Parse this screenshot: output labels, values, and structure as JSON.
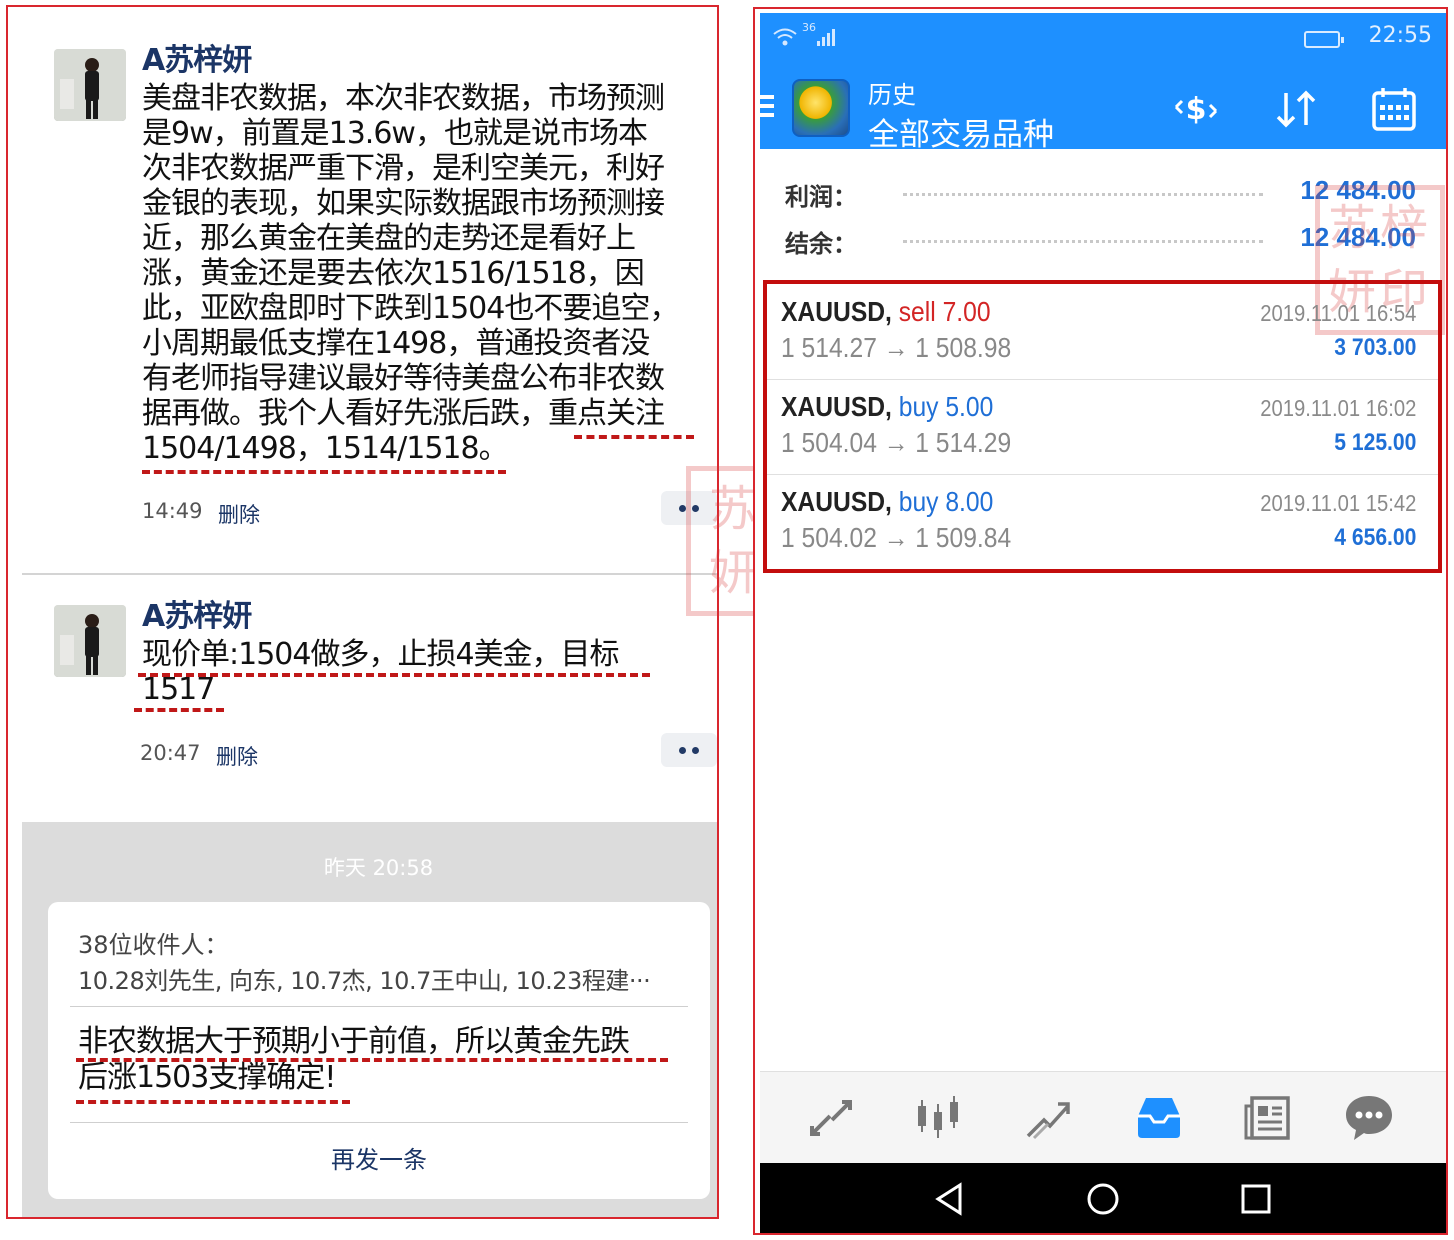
{
  "moments": {
    "posts": [
      {
        "author": "A苏梓妍",
        "lines": [
          "美盘非农数据，本次非农数据，市场预测",
          "是9w，前置是13.6w，也就是说市场本",
          "次非农数据严重下滑，是利空美元，利好",
          "金银的表现，如果实际数据跟市场预测接",
          "近，那么黄金在美盘的走势还是看好上",
          "涨，黄金还是要去依次1516/1518，因",
          "此，亚欧盘即时下跌到1504也不要追空，",
          "小周期最低支撑在1498，普通投资者没",
          "有老师指导建议最好等待美盘公布非农数",
          "据再做。我个人看好先涨后跌，重点关注",
          "1504/1498，1514/1518。"
        ],
        "time": "14:49",
        "delete_label": "删除"
      },
      {
        "author": "A苏梓妍",
        "lines": [
          "现价单:1504做多，止损4美金，目标",
          "1517"
        ],
        "time": "20:47",
        "delete_label": "删除"
      }
    ],
    "group_send": {
      "timestamp": "昨天 20:58",
      "recipients_label": "38位收件人：",
      "recipients": "10.28刘先生, 向东, 10.7杰, 10.7王中山, 10.23程建···",
      "message_lines": [
        "非农数据大于预期小于前值，所以黄金先跌",
        "后涨1503支撑确定!"
      ],
      "resend_label": "再发一条"
    },
    "watermark": "苏梓妍印"
  },
  "mt4": {
    "status_bar": {
      "time": "22:55",
      "signal_label": "36"
    },
    "header": {
      "title": "历史",
      "subtitle": "全部交易品种"
    },
    "summary": [
      {
        "label": "利润：",
        "value": "12 484.00"
      },
      {
        "label": "结余：",
        "value": "12 484.00"
      }
    ],
    "trades": [
      {
        "symbol": "XAUUSD,",
        "side": "sell",
        "volume": "7.00",
        "open": "1 514.27",
        "close": "1 508.98",
        "arrow": "→",
        "datetime": "2019.11.01 16:54",
        "profit": "3 703.00"
      },
      {
        "symbol": "XAUUSD,",
        "side": "buy",
        "volume": "5.00",
        "open": "1 504.04",
        "close": "1 514.29",
        "arrow": "→",
        "datetime": "2019.11.01 16:02",
        "profit": "5 125.00"
      },
      {
        "symbol": "XAUUSD,",
        "side": "buy",
        "volume": "8.00",
        "open": "1 504.02",
        "close": "1 509.84",
        "arrow": "→",
        "datetime": "2019.11.01 15:42",
        "profit": "4 656.00"
      }
    ],
    "colors": {
      "accent": "#1e90ff",
      "sell": "#d32525",
      "buy": "#1f6fd6",
      "highlight": "#c30d0d"
    },
    "bottom_tabs": [
      "quotes-icon",
      "chart-icon",
      "trade-icon",
      "history-icon",
      "news-icon",
      "chat-icon"
    ],
    "active_tab": "history-icon"
  }
}
